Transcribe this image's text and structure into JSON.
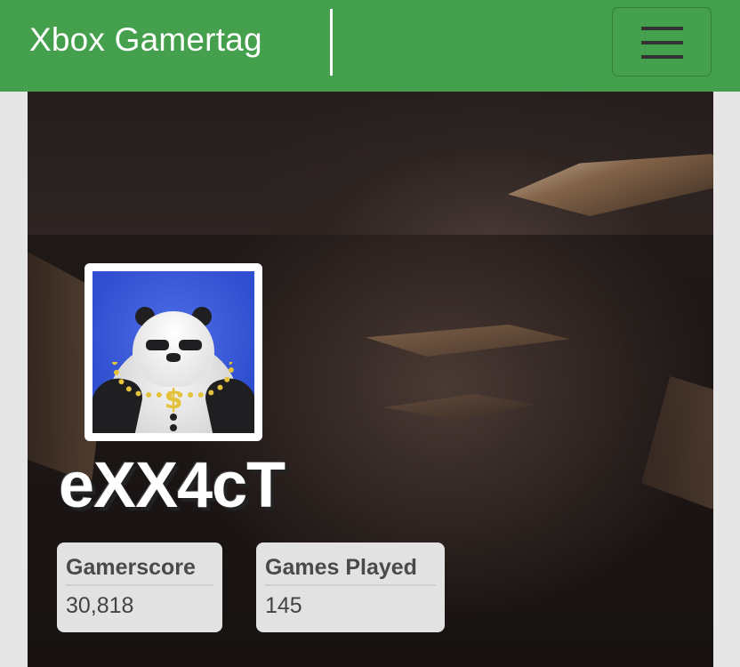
{
  "navbar": {
    "brand": "Xbox Gamertag",
    "menu_icon": "hamburger-menu-icon"
  },
  "profile": {
    "gamertag": "eXX4cT",
    "avatar_icon": "panda-avatar",
    "avatar_pendant": "$"
  },
  "stats": [
    {
      "label": "Gamerscore",
      "value": "30,818"
    },
    {
      "label": "Games Played",
      "value": "145"
    }
  ],
  "colors": {
    "navbar_green": "#44a04c",
    "page_background": "#e6e6e6",
    "card_background": "#e2e2e2",
    "avatar_blue": "#3a5bdc"
  }
}
